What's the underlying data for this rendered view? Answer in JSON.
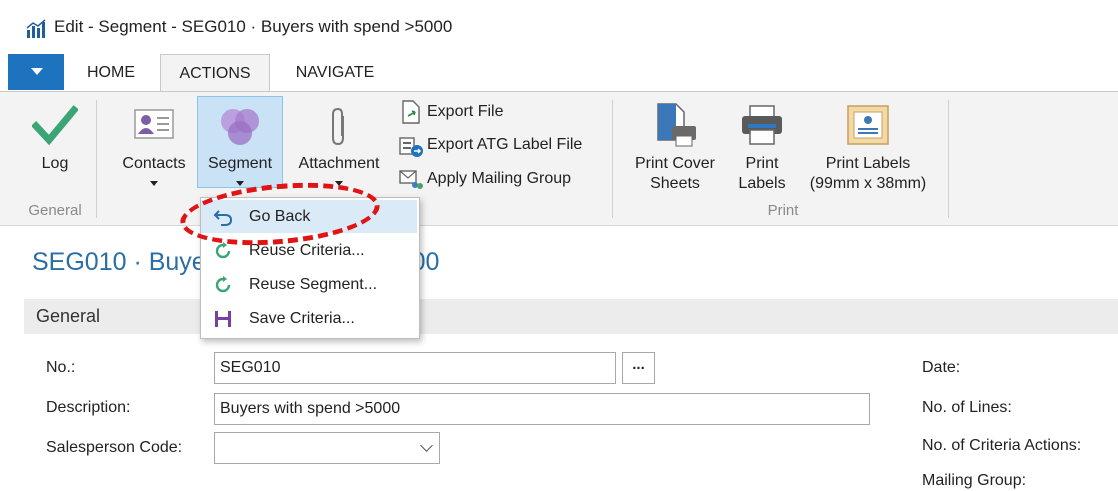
{
  "window": {
    "title": "Edit - Segment - SEG010 · Buyers with spend >5000"
  },
  "tabs": [
    {
      "label": "HOME"
    },
    {
      "label": "ACTIONS"
    },
    {
      "label": "NAVIGATE"
    }
  ],
  "ribbon": {
    "general": {
      "group_label": "General",
      "log_label": "Log"
    },
    "contacts_label": "Contacts",
    "segment_label": "Segment",
    "attachment_label": "Attachment",
    "export_file_label": "Export File",
    "export_atg_label": "Export ATG Label File",
    "apply_mailing_label": "Apply Mailing Group",
    "print": {
      "group_label": "Print",
      "cover_line1": "Print Cover",
      "cover_line2": "Sheets",
      "labels_line1": "Print",
      "labels_line2": "Labels",
      "labels99_line1": "Print Labels",
      "labels99_line2": "(99mm x 38mm)"
    }
  },
  "segment_menu": {
    "items": [
      {
        "label": "Go Back",
        "icon": "undo-arrow-icon"
      },
      {
        "label": "Reuse Criteria...",
        "icon": "reuse-criteria-icon"
      },
      {
        "label": "Reuse Segment...",
        "icon": "reuse-segment-icon"
      },
      {
        "label": "Save Criteria...",
        "icon": "save-icon"
      }
    ]
  },
  "page": {
    "title_left": "SEG010 · Buye",
    "title_right": "000",
    "section": "General"
  },
  "form": {
    "no_label": "No.:",
    "no_value": "SEG010",
    "dots": "...",
    "description_label": "Description:",
    "description_value": "Buyers with spend >5000",
    "salesperson_label": "Salesperson Code:",
    "salesperson_value": "",
    "date_label": "Date:",
    "lines_label": "No. of Lines:",
    "criteria_actions_label": "No. of Criteria Actions:",
    "mailing_group_label": "Mailing Group:"
  },
  "colors": {
    "accent": "#1e73be",
    "title_blue": "#2a6ea6",
    "annotation": "#e01414"
  }
}
